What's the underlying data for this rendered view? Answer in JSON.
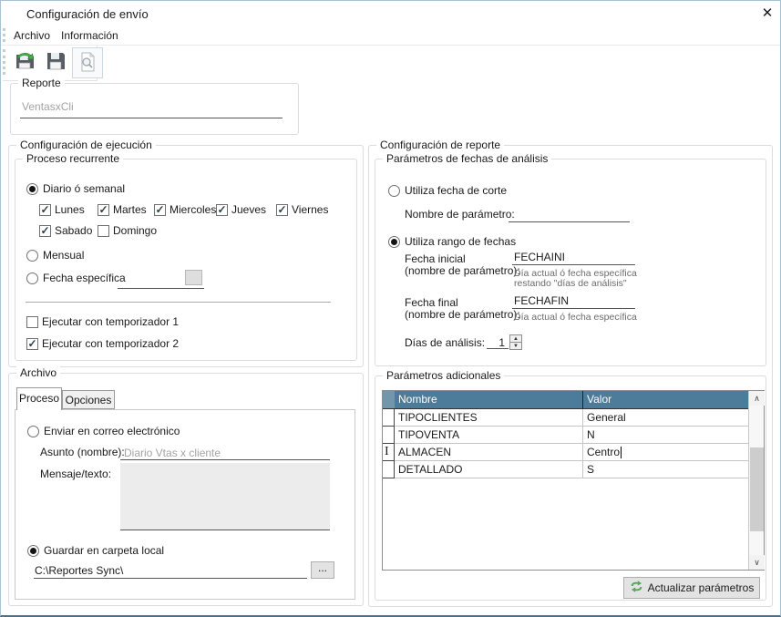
{
  "window": {
    "title": "Configuración de envío"
  },
  "icons": {
    "check": "✓",
    "close": "✕",
    "spin_up": "▲",
    "spin_down": "▼",
    "scroll_up": "∧",
    "scroll_down": "∨",
    "ibeam": "I"
  },
  "menu": {
    "items": [
      {
        "label": "Archivo"
      },
      {
        "label": "Información"
      }
    ]
  },
  "report": {
    "legend": "Reporte",
    "value": "VentasxCli"
  },
  "execution": {
    "legend": "Configuración de ejecución",
    "recurrent": {
      "legend": "Proceso recurrente",
      "daily_label": "Diario ó semanal",
      "days": [
        {
          "label": "Lunes",
          "checked": true
        },
        {
          "label": "Martes",
          "checked": true
        },
        {
          "label": "Miercoles",
          "checked": true
        },
        {
          "label": "Jueves",
          "checked": true
        },
        {
          "label": "Viernes",
          "checked": true
        },
        {
          "label": "Sabado",
          "checked": true
        },
        {
          "label": "Domingo",
          "checked": false
        }
      ],
      "monthly_label": "Mensual",
      "specific_label": "Fecha específica",
      "timer1_label": "Ejecutar con temporizador 1",
      "timer2_label": "Ejecutar con temporizador 2"
    }
  },
  "file": {
    "legend": "Archivo",
    "tabs": [
      {
        "label": "Proceso"
      },
      {
        "label": "Opciones"
      }
    ],
    "email_label": "Enviar en correo electrónico",
    "subject_label": "Asunto (nombre):",
    "subject_value": "Diario Vtas x cliente",
    "message_label": "Mensaje/texto:",
    "save_local_label": "Guardar en carpeta local",
    "path_value": "C:\\Reportes Sync\\",
    "browse_label": "..."
  },
  "report_config": {
    "legend": "Configuración de reporte",
    "dates": {
      "legend": "Parámetros de fechas de análisis",
      "cutoff_label": "Utiliza fecha de corte",
      "param_name_label": "Nombre de parámetro:",
      "range_label": "Utiliza rango de fechas",
      "start_label_1": "Fecha inicial",
      "start_label_2": "(nombre de parámetro):",
      "start_value": "FECHAINI",
      "start_help_1": "Día actual ó fecha específica",
      "start_help_2": "restando \"días de análisis\"",
      "end_label_1": "Fecha final",
      "end_label_2": "(nombre de parámetro):",
      "end_value": "FECHAFIN",
      "end_help": "Día actual ó fecha específica",
      "days_label": "Días de análisis:",
      "days_value": "1"
    },
    "params": {
      "legend": "Parámetros adicionales",
      "columns": [
        "Nombre",
        "Valor"
      ],
      "rows": [
        {
          "name": "TIPOCLIENTES",
          "value": "General"
        },
        {
          "name": "TIPOVENTA",
          "value": "N"
        },
        {
          "name": "ALMACEN",
          "value": "Centro"
        },
        {
          "name": "DETALLADO",
          "value": "S"
        }
      ],
      "update_button": "Actualizar parámetros"
    }
  }
}
